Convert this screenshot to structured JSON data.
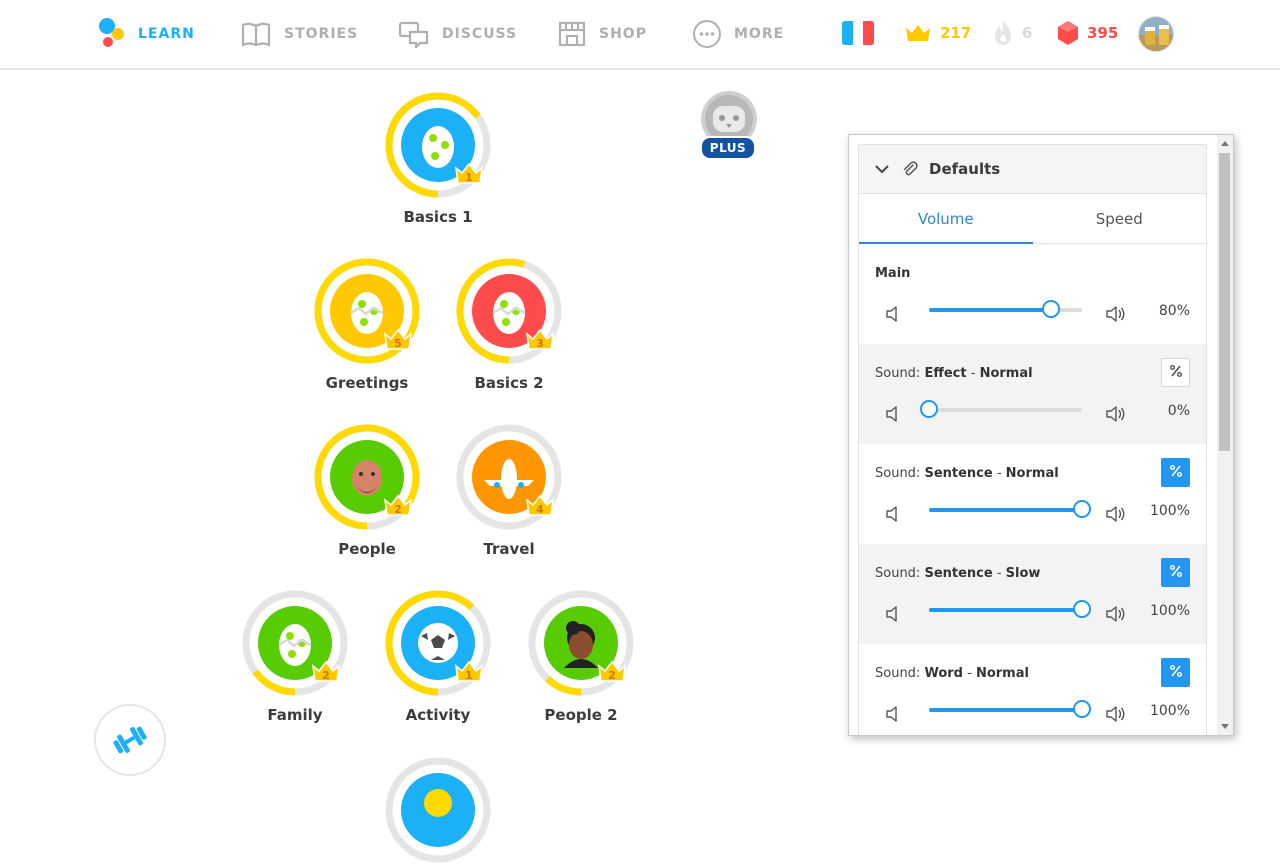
{
  "nav": {
    "learn": "LEARN",
    "stories": "STORIES",
    "discuss": "DISCUSS",
    "shop": "SHOP",
    "more": "MORE"
  },
  "stats": {
    "language_flag": "france-flag",
    "crowns": "217",
    "streak": "6",
    "gems": "395"
  },
  "colors": {
    "accent": "#1cb0f6",
    "gold": "#ffc800",
    "gem_red": "#ff4b4b",
    "panel_blue": "#2196f3"
  },
  "skills": [
    {
      "label": "Basics 1",
      "level": "1",
      "progress": 0.65,
      "color": "#1cb0f6",
      "icon": "egg-icon"
    },
    {
      "label": "Greetings",
      "level": "5",
      "progress": 1.0,
      "color": "#ffc800",
      "icon": "cracked-egg-icon"
    },
    {
      "label": "Basics 2",
      "level": "3",
      "progress": 0.55,
      "color": "#ff4b4b",
      "icon": "cracked-egg-icon"
    },
    {
      "label": "People",
      "level": "2",
      "progress": 0.85,
      "color": "#58cc02",
      "icon": "bearded-man-icon"
    },
    {
      "label": "Travel",
      "level": "4",
      "progress": 0.0,
      "color": "#ff9600",
      "icon": "airplane-icon"
    },
    {
      "label": "Family",
      "level": "2",
      "progress": 0.15,
      "color": "#58cc02",
      "icon": "cracked-egg-icon"
    },
    {
      "label": "Activity",
      "level": "1",
      "progress": 0.62,
      "color": "#1cb0f6",
      "icon": "soccer-ball-icon"
    },
    {
      "label": "People 2",
      "level": "2",
      "progress": 0.12,
      "color": "#58cc02",
      "icon": "woman-icon"
    }
  ],
  "plus_badge": "PLUS",
  "panel": {
    "title": "Defaults",
    "tabs": [
      "Volume",
      "Speed"
    ],
    "rows": [
      {
        "prefix": "",
        "strong1": "Main",
        "sep": "",
        "strong2": "",
        "value": "80%",
        "level": 0.8,
        "has_toggle": false,
        "toggle_on": false
      },
      {
        "prefix": "Sound: ",
        "strong1": "Effect",
        "sep": " - ",
        "strong2": "Normal",
        "value": "0%",
        "level": 0.0,
        "has_toggle": true,
        "toggle_on": false
      },
      {
        "prefix": "Sound: ",
        "strong1": "Sentence",
        "sep": " - ",
        "strong2": "Normal",
        "value": "100%",
        "level": 1.0,
        "has_toggle": true,
        "toggle_on": true
      },
      {
        "prefix": "Sound: ",
        "strong1": "Sentence",
        "sep": " - ",
        "strong2": "Slow",
        "value": "100%",
        "level": 1.0,
        "has_toggle": true,
        "toggle_on": true
      },
      {
        "prefix": "Sound: ",
        "strong1": "Word",
        "sep": " - ",
        "strong2": "Normal",
        "value": "100%",
        "level": 1.0,
        "has_toggle": true,
        "toggle_on": true
      }
    ]
  }
}
